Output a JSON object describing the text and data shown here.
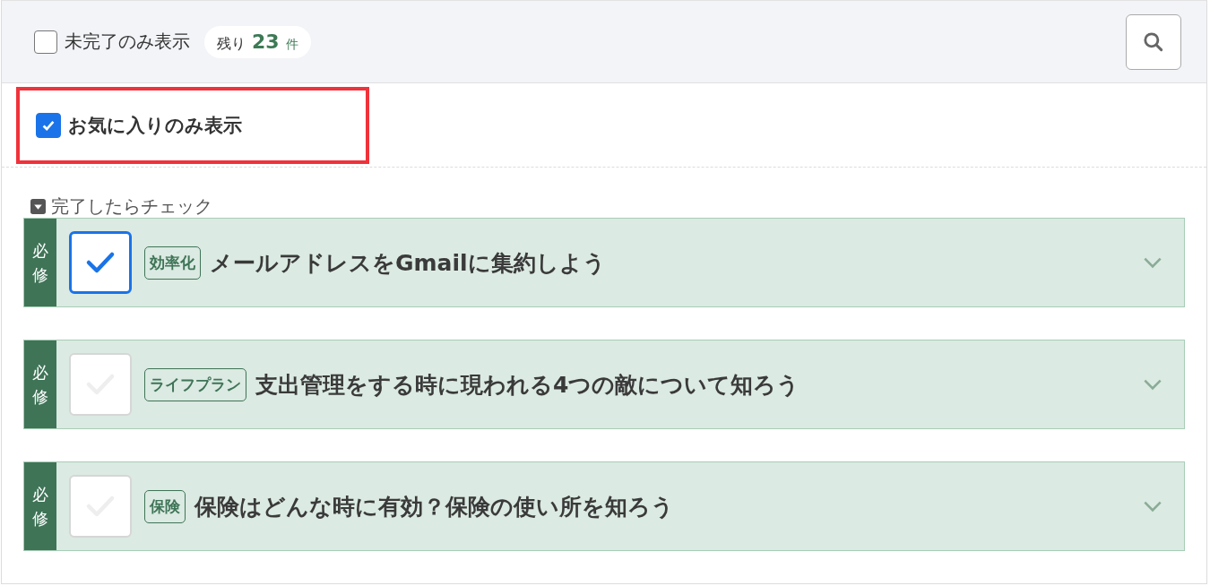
{
  "filters": {
    "incomplete_only": {
      "label": "未完了のみ表示",
      "checked": false
    },
    "remaining": {
      "prefix": "残り",
      "count": "23",
      "unit": "件"
    },
    "favorites_only": {
      "label": "お気に入りのみ表示",
      "checked": true,
      "highlighted": true
    }
  },
  "section_label": "完了したらチェック",
  "tasks": [
    {
      "badge": "必修",
      "checked": true,
      "category": "効率化",
      "title": "メールアドレスをGmailに集約しよう",
      "expanded": false
    },
    {
      "badge": "必修",
      "checked": false,
      "category": "ライフプラン",
      "title": "支出管理をする時に現われる4つの敵について知ろう",
      "expanded": false
    },
    {
      "badge": "必修",
      "checked": false,
      "category": "保険",
      "title": "保険はどんな時に有効？保険の使い所を知ろう",
      "expanded": false
    }
  ]
}
